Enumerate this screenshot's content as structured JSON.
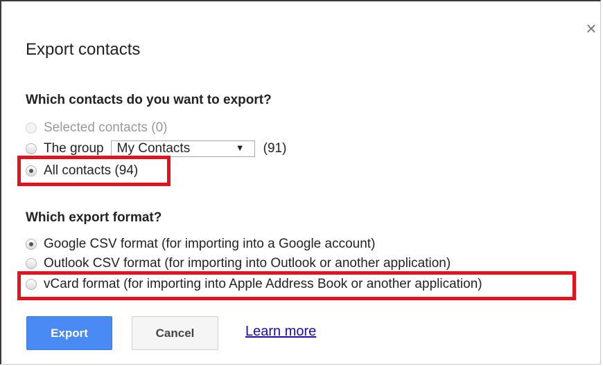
{
  "dialog": {
    "title": "Export contacts",
    "close_glyph": "×"
  },
  "contacts_section": {
    "heading": "Which contacts do you want to export?",
    "options": [
      {
        "label": "Selected contacts (0)",
        "checked": false,
        "disabled": true
      },
      {
        "label": "The group",
        "checked": false,
        "disabled": false
      },
      {
        "label": "All contacts (94)",
        "checked": true,
        "disabled": false
      }
    ],
    "group_select": {
      "value": "My Contacts",
      "arrow": "▼"
    },
    "group_count": "(91)"
  },
  "format_section": {
    "heading": "Which export format?",
    "options": [
      {
        "label": "Google CSV format (for importing into a Google account)",
        "checked": true
      },
      {
        "label": "Outlook CSV format (for importing into Outlook or another application)",
        "checked": false
      },
      {
        "label": "vCard format (for importing into Apple Address Book or another application)",
        "checked": false
      }
    ]
  },
  "buttons": {
    "export": "Export",
    "cancel": "Cancel",
    "learn_more": "Learn more"
  },
  "colors": {
    "highlight": "#e3121d",
    "primary_button": "#4a8af4",
    "link": "#1a0dab"
  },
  "icons": {
    "close": "close-icon",
    "dropdown": "chevron-down-icon"
  }
}
